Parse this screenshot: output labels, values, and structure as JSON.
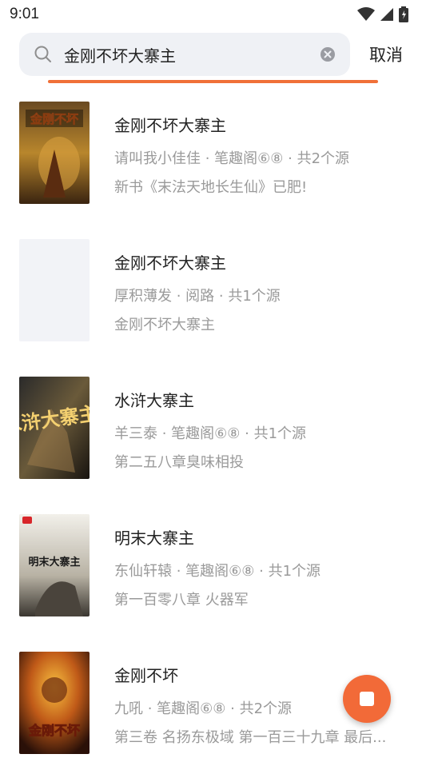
{
  "status": {
    "time": "9:01",
    "icons": [
      "wifi-icon",
      "signal-icon",
      "battery-icon"
    ]
  },
  "search": {
    "query": "金刚不坏大寨主",
    "cancel_label": "取消"
  },
  "colors": {
    "accent": "#f07038",
    "text_primary": "#222222",
    "text_secondary": "#9a9a9a",
    "search_bg": "#eff1f5"
  },
  "results": [
    {
      "title": "金刚不坏大寨主",
      "meta": "请叫我小佳佳 · 笔趣阁⑥⑧ · 共2个源",
      "latest": "新书《末法天地长生仙》已肥!",
      "cover_text": "金刚不坏"
    },
    {
      "title": "金刚不坏大寨主",
      "meta": "厚积薄发 · 阅路 · 共1个源",
      "latest": "金刚不坏大寨主",
      "cover_text": ""
    },
    {
      "title": "水浒大寨主",
      "meta": "羊三泰 · 笔趣阁⑥⑧ · 共1个源",
      "latest": "第二五八章臭味相投",
      "cover_text": "水浒大寨主"
    },
    {
      "title": "明末大寨主",
      "meta": "东仙轩辕 · 笔趣阁⑥⑧ · 共1个源",
      "latest": "第一百零八章 火器军",
      "cover_text": "明末大寨主"
    },
    {
      "title": "金刚不坏",
      "meta": "九吼 · 笔趣阁⑥⑧ · 共2个源",
      "latest": "第三卷 名扬东极域 第一百三十九章 最后...",
      "cover_text": "金刚不坏"
    }
  ]
}
